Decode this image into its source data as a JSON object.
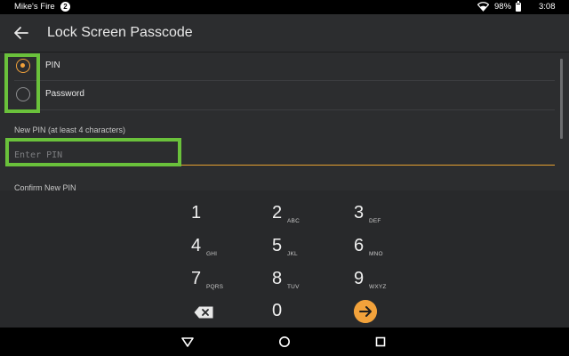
{
  "status_bar": {
    "device_name": "Mike's Fire",
    "notification_count": "2",
    "wifi_icon": "wifi-icon",
    "battery": "98%",
    "time": "3:08"
  },
  "app_bar": {
    "back_icon": "back-arrow-icon",
    "title": "Lock Screen Passcode"
  },
  "options": {
    "pin_label": "PIN",
    "password_label": "Password",
    "selected": "PIN"
  },
  "new_pin": {
    "label": "New PIN (at least 4 characters)",
    "placeholder": "Enter PIN",
    "value": ""
  },
  "confirm_pin": {
    "label": "Confirm New PIN"
  },
  "keypad": {
    "keys": [
      {
        "num": "1",
        "letters": ""
      },
      {
        "num": "2",
        "letters": "ABC"
      },
      {
        "num": "3",
        "letters": "DEF"
      },
      {
        "num": "4",
        "letters": "GHI"
      },
      {
        "num": "5",
        "letters": "JKL"
      },
      {
        "num": "6",
        "letters": "MNO"
      },
      {
        "num": "7",
        "letters": "PQRS"
      },
      {
        "num": "8",
        "letters": "TUV"
      },
      {
        "num": "9",
        "letters": "WXYZ"
      },
      {
        "num": "0",
        "letters": ""
      }
    ],
    "backspace_icon": "backspace-icon",
    "go_icon": "go-arrow-icon"
  },
  "nav_bar": {
    "back_icon": "nav-back-triangle-icon",
    "home_icon": "nav-home-circle-icon",
    "recents_icon": "nav-recents-square-icon"
  },
  "colors": {
    "accent": "#f2a23b",
    "highlight": "#6ac13b",
    "surface": "#2c2d2f",
    "keypad": "#28292b"
  }
}
